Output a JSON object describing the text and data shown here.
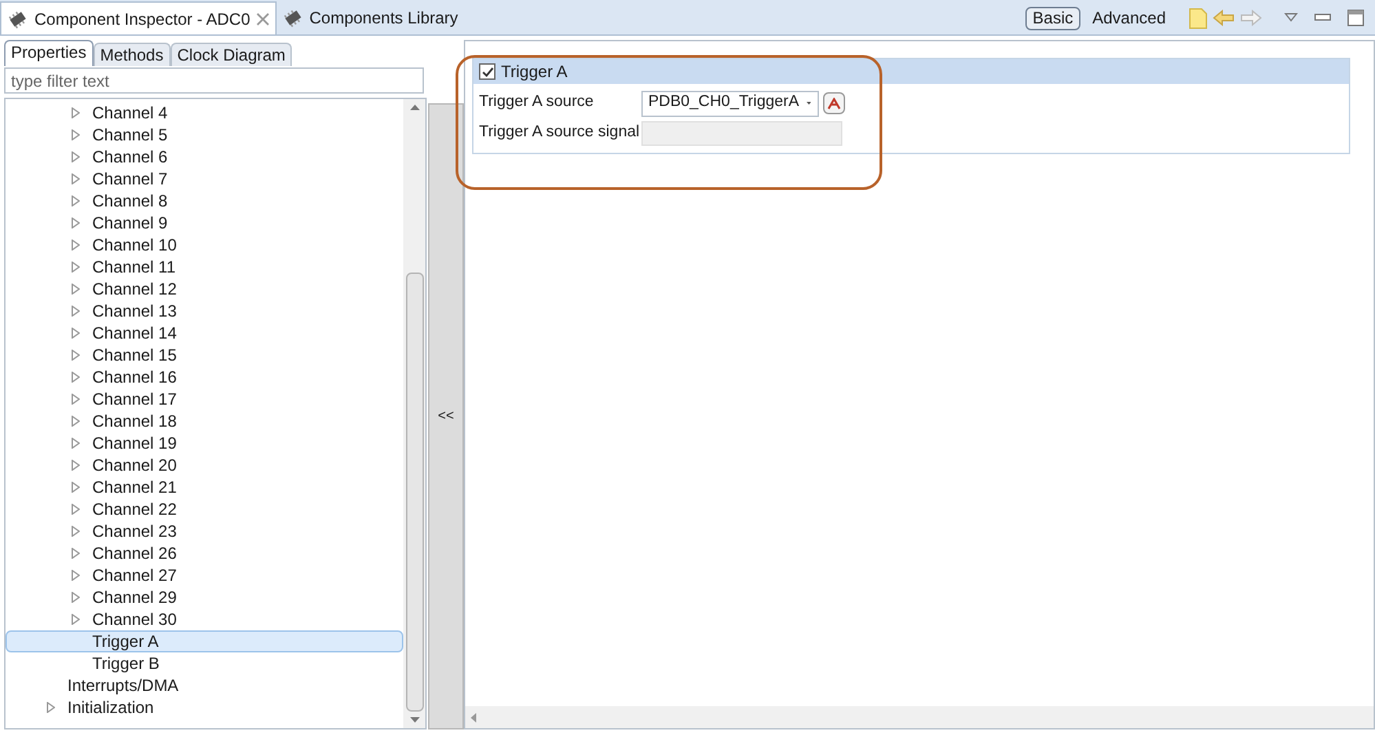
{
  "editor_tabs": [
    {
      "label": "Component Inspector - ADC0",
      "selected": true,
      "closable": true
    },
    {
      "label": "Components Library",
      "selected": false,
      "closable": false
    }
  ],
  "view_modes": [
    {
      "label": "Basic",
      "selected": true
    },
    {
      "label": "Advanced",
      "selected": false
    }
  ],
  "inspector_tabs": [
    {
      "label": "Properties",
      "selected": true
    },
    {
      "label": "Methods",
      "selected": false
    },
    {
      "label": "Clock Diagram",
      "selected": false
    }
  ],
  "filter": {
    "placeholder": "type filter text"
  },
  "tree": [
    {
      "children": [
        {
          "label": "Channel 4",
          "expandable": true,
          "selected": false
        },
        {
          "label": "Channel 5",
          "expandable": true,
          "selected": false
        },
        {
          "label": "Channel 6",
          "expandable": true,
          "selected": false
        },
        {
          "label": "Channel 7",
          "expandable": true,
          "selected": false
        },
        {
          "label": "Channel 8",
          "expandable": true,
          "selected": false
        },
        {
          "label": "Channel 9",
          "expandable": true,
          "selected": false
        },
        {
          "label": "Channel 10",
          "expandable": true,
          "selected": false
        },
        {
          "label": "Channel 11",
          "expandable": true,
          "selected": false
        },
        {
          "label": "Channel 12",
          "expandable": true,
          "selected": false
        },
        {
          "label": "Channel 13",
          "expandable": true,
          "selected": false
        },
        {
          "label": "Channel 14",
          "expandable": true,
          "selected": false
        },
        {
          "label": "Channel 15",
          "expandable": true,
          "selected": false
        },
        {
          "label": "Channel 16",
          "expandable": true,
          "selected": false
        },
        {
          "label": "Channel 17",
          "expandable": true,
          "selected": false
        },
        {
          "label": "Channel 18",
          "expandable": true,
          "selected": false
        },
        {
          "label": "Channel 19",
          "expandable": true,
          "selected": false
        },
        {
          "label": "Channel 20",
          "expandable": true,
          "selected": false
        },
        {
          "label": "Channel 21",
          "expandable": true,
          "selected": false
        },
        {
          "label": "Channel 22",
          "expandable": true,
          "selected": false
        },
        {
          "label": "Channel 23",
          "expandable": true,
          "selected": false
        },
        {
          "label": "Channel 26",
          "expandable": true,
          "selected": false
        },
        {
          "label": "Channel 27",
          "expandable": true,
          "selected": false
        },
        {
          "label": "Channel 29",
          "expandable": true,
          "selected": false
        },
        {
          "label": "Channel 30",
          "expandable": true,
          "selected": false
        },
        {
          "label": "Trigger A",
          "expandable": false,
          "selected": true
        },
        {
          "label": "Trigger B",
          "expandable": false,
          "selected": false
        }
      ]
    },
    {
      "label": "Interrupts/DMA",
      "expandable": false,
      "selected": false
    },
    {
      "label": "Initialization",
      "expandable": true,
      "selected": false
    }
  ],
  "collapse_button": "<<",
  "group": {
    "title": "Trigger A",
    "checked": true,
    "rows": [
      {
        "kind": "dropdown",
        "label": "Trigger A source",
        "value": "PDB0_CH0_TriggerA"
      },
      {
        "kind": "readonly",
        "label": "Trigger A source signal"
      }
    ]
  }
}
